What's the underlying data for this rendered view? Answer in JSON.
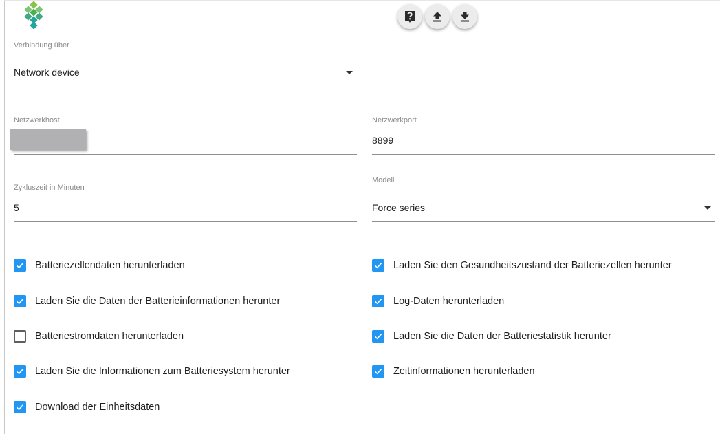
{
  "toolbar": {
    "icons": [
      "help-icon",
      "upload-icon",
      "download-icon"
    ]
  },
  "connection": {
    "label": "Verbindung über",
    "value": "Network device"
  },
  "host": {
    "label": "Netzwerkhost"
  },
  "port": {
    "label": "Netzwerkport",
    "value": "8899"
  },
  "cycle": {
    "label": "Zykluszeit in Minuten",
    "value": "5"
  },
  "model": {
    "label": "Modell",
    "value": "Force series"
  },
  "options": [
    {
      "label": "Batteriezellendaten herunterladen",
      "checked": true
    },
    {
      "label": "Laden Sie den Gesundheitszustand der Batteriezellen herunter",
      "checked": true
    },
    {
      "label": "Laden Sie die Daten der Batterieinformationen herunter",
      "checked": true
    },
    {
      "label": "Log-Daten herunterladen",
      "checked": true
    },
    {
      "label": "Batteriestromdaten herunterladen",
      "checked": false
    },
    {
      "label": "Laden Sie die Daten der Batteriestatistik herunter",
      "checked": true
    },
    {
      "label": "Laden Sie die Informationen zum Batteriesystem herunter",
      "checked": true
    },
    {
      "label": "Zeitinformationen herunterladen",
      "checked": true
    },
    {
      "label": "Download der Einheitsdaten",
      "checked": true
    }
  ],
  "colors": {
    "checkbox_on": "#2196f3",
    "logo_green": "#66bb6a",
    "logo_teal": "#26a69a"
  }
}
